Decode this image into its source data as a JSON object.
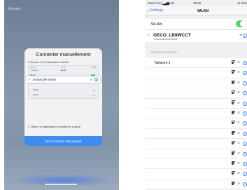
{
  "left_screen": {
    "cancel_label": "Annuler",
    "dialog": {
      "title": "Connecter manuellement",
      "step1": "1.Ouvrez Les Paramètres WLAN",
      "mini_settings": {
        "status_left": "Carrier",
        "status_time": "9:41",
        "status_right": "100%",
        "back_label": "< Settings",
        "title": "WLAN",
        "wlan_label": "WLAN",
        "choose_header": "CHOOSE A NETWORK...",
        "network_a": "Family",
        "network_b": "Partner"
      },
      "highlight_network": "SmartLife-XXXX",
      "step2": "2. Retour à l'application et continuer à ajout",
      "connect_button": "Se Connecter Maintenant"
    }
  },
  "right_screen": {
    "status_bar": {
      "carrier": "Orenz Cel",
      "signal_text": "4G",
      "time": "15:34",
      "battery": "43%"
    },
    "nav": {
      "back_label": "Settings",
      "title": "WLAN"
    },
    "wlan_row": {
      "label": "WLAN",
      "toggle_on": true
    },
    "connected_network": {
      "name": "OECO_LB9WCCT",
      "subtitle": "Unsecured Network"
    },
    "choose_header": "CHOOSE A NETWORK...",
    "networks": [
      {
        "name": "Network 1"
      },
      {
        "name": ""
      },
      {
        "name": ""
      },
      {
        "name": ""
      },
      {
        "name": ""
      },
      {
        "name": ""
      },
      {
        "name": ""
      },
      {
        "name": ""
      },
      {
        "name": ""
      },
      {
        "name": ""
      },
      {
        "name": ""
      },
      {
        "name": ""
      },
      {
        "name": ""
      }
    ]
  },
  "colors": {
    "ios_blue": "#2f7cf6",
    "toggle_green": "#4cd964",
    "connect_button": "#3d8cf0"
  }
}
